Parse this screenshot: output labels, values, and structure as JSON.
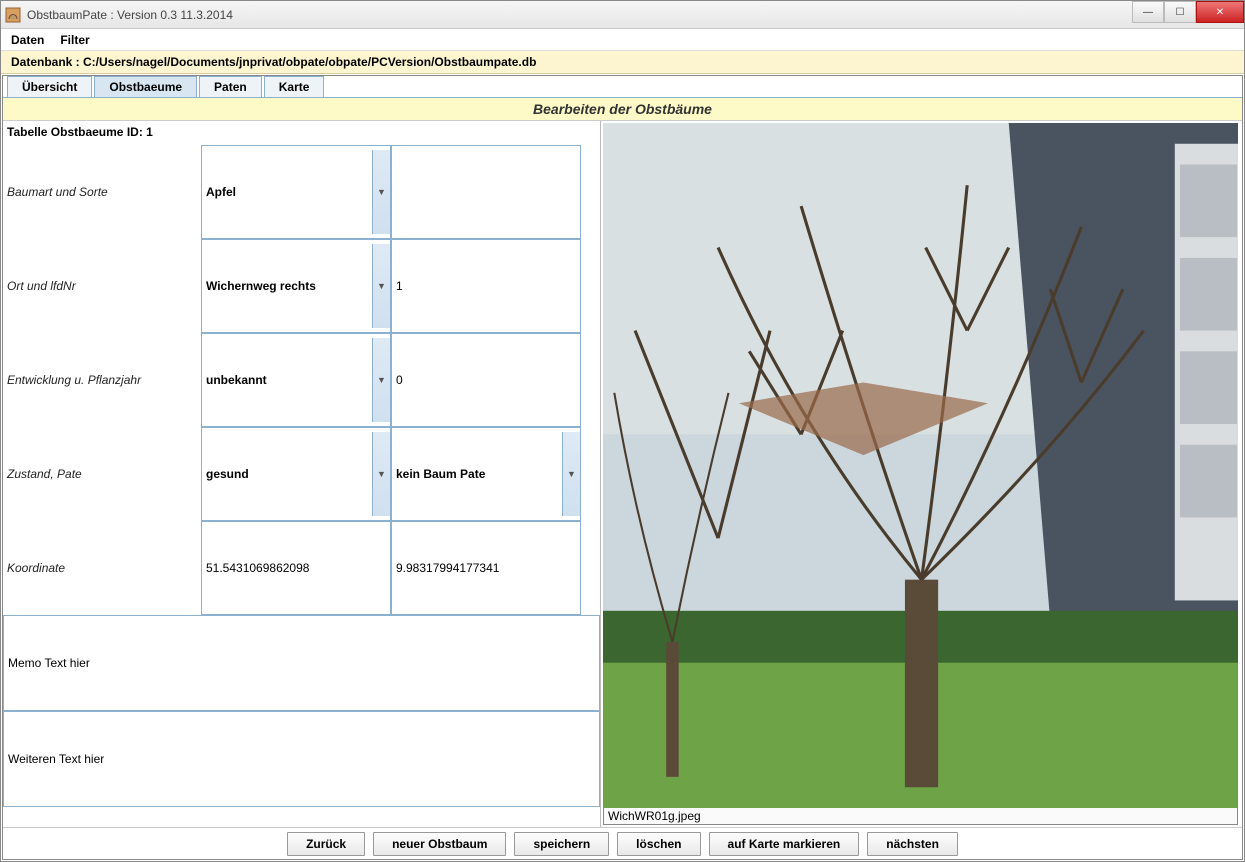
{
  "window": {
    "title": "ObstbaumPate : Version 0.3 11.3.2014"
  },
  "menu": {
    "items": [
      "Daten",
      "Filter"
    ]
  },
  "db_path_label": "Datenbank : C:/Users/nagel/Documents/jnprivat/obpate/obpate/PCVersion/Obstbaumpate.db",
  "tabs": {
    "items": [
      "Übersicht",
      "Obstbaeume",
      "Paten",
      "Karte"
    ],
    "selected_index": 1
  },
  "edit_title": "Bearbeiten der Obstbäume",
  "table_id_label": "Tabelle Obstbaeume ID: 1",
  "rows": {
    "baumart": {
      "label": "Baumart und Sorte",
      "value1": "Apfel",
      "value2": ""
    },
    "ort": {
      "label": "Ort und lfdNr",
      "value1": "Wichernweg rechts",
      "value2": "1"
    },
    "entwicklung": {
      "label": "Entwicklung u. Pflanzjahr",
      "value1": "unbekannt",
      "value2": "0"
    },
    "zustand": {
      "label": "Zustand, Pate",
      "value1": "gesund",
      "value2": "kein Baum Pate"
    },
    "koordinate": {
      "label": "Koordinate",
      "value1": "51.5431069862098",
      "value2": "9.98317994177341"
    }
  },
  "memo1": "Memo Text hier",
  "memo2": "Weiteren Text hier",
  "photo_filename": "WichWR01g.jpeg",
  "buttons": {
    "back": "Zurück",
    "new": "neuer Obstbaum",
    "save": "speichern",
    "delete": "löschen",
    "mark": "auf Karte markieren",
    "next": "nächsten"
  }
}
